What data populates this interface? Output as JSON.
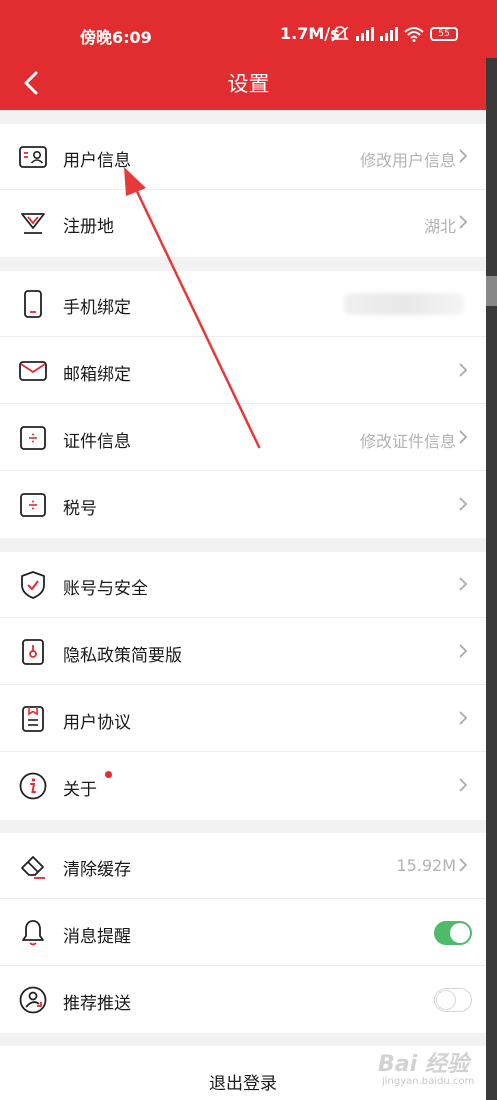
{
  "status_bar": {
    "time": "傍晚6:09",
    "network_speed": "1.7M/s",
    "battery": "55"
  },
  "nav": {
    "title": "设置"
  },
  "groups": [
    {
      "rows": [
        {
          "label": "用户信息",
          "value": "修改用户信息",
          "icon": "user-card-icon",
          "control": "chevron"
        },
        {
          "label": "注册地",
          "value": "湖北",
          "icon": "location-icon",
          "control": "chevron"
        }
      ]
    },
    {
      "rows": [
        {
          "label": "手机绑定",
          "value": "",
          "icon": "phone-icon",
          "control": "chevron"
        },
        {
          "label": "邮箱绑定",
          "value": "",
          "icon": "mail-icon",
          "control": "chevron"
        },
        {
          "label": "证件信息",
          "value": "修改证件信息",
          "icon": "id-document-icon",
          "control": "chevron"
        },
        {
          "label": "税号",
          "value": "",
          "icon": "tax-icon",
          "control": "chevron"
        }
      ]
    },
    {
      "rows": [
        {
          "label": "账号与安全",
          "value": "",
          "icon": "shield-icon",
          "control": "chevron"
        },
        {
          "label": "隐私政策简要版",
          "value": "",
          "icon": "privacy-icon",
          "control": "chevron"
        },
        {
          "label": "用户协议",
          "value": "",
          "icon": "agreement-icon",
          "control": "chevron"
        },
        {
          "label": "关于",
          "value": "",
          "icon": "info-icon",
          "control": "chevron",
          "badge": true
        }
      ]
    },
    {
      "rows": [
        {
          "label": "清除缓存",
          "value": "15.92M",
          "icon": "eraser-icon",
          "control": "chevron"
        },
        {
          "label": "消息提醒",
          "value": "",
          "icon": "bell-icon",
          "control": "toggle",
          "toggle_on": true
        },
        {
          "label": "推荐推送",
          "value": "",
          "icon": "recommend-icon",
          "control": "toggle",
          "toggle_on": false
        }
      ]
    }
  ],
  "logout": {
    "label": "退出登录"
  },
  "watermark": {
    "brand": "Bai 经验",
    "site": "jingyan.baidu.com"
  },
  "colors": {
    "accent": "#e12d2f",
    "toggle_on": "#4cbb6a",
    "annotation_arrow": "#e8383a"
  }
}
